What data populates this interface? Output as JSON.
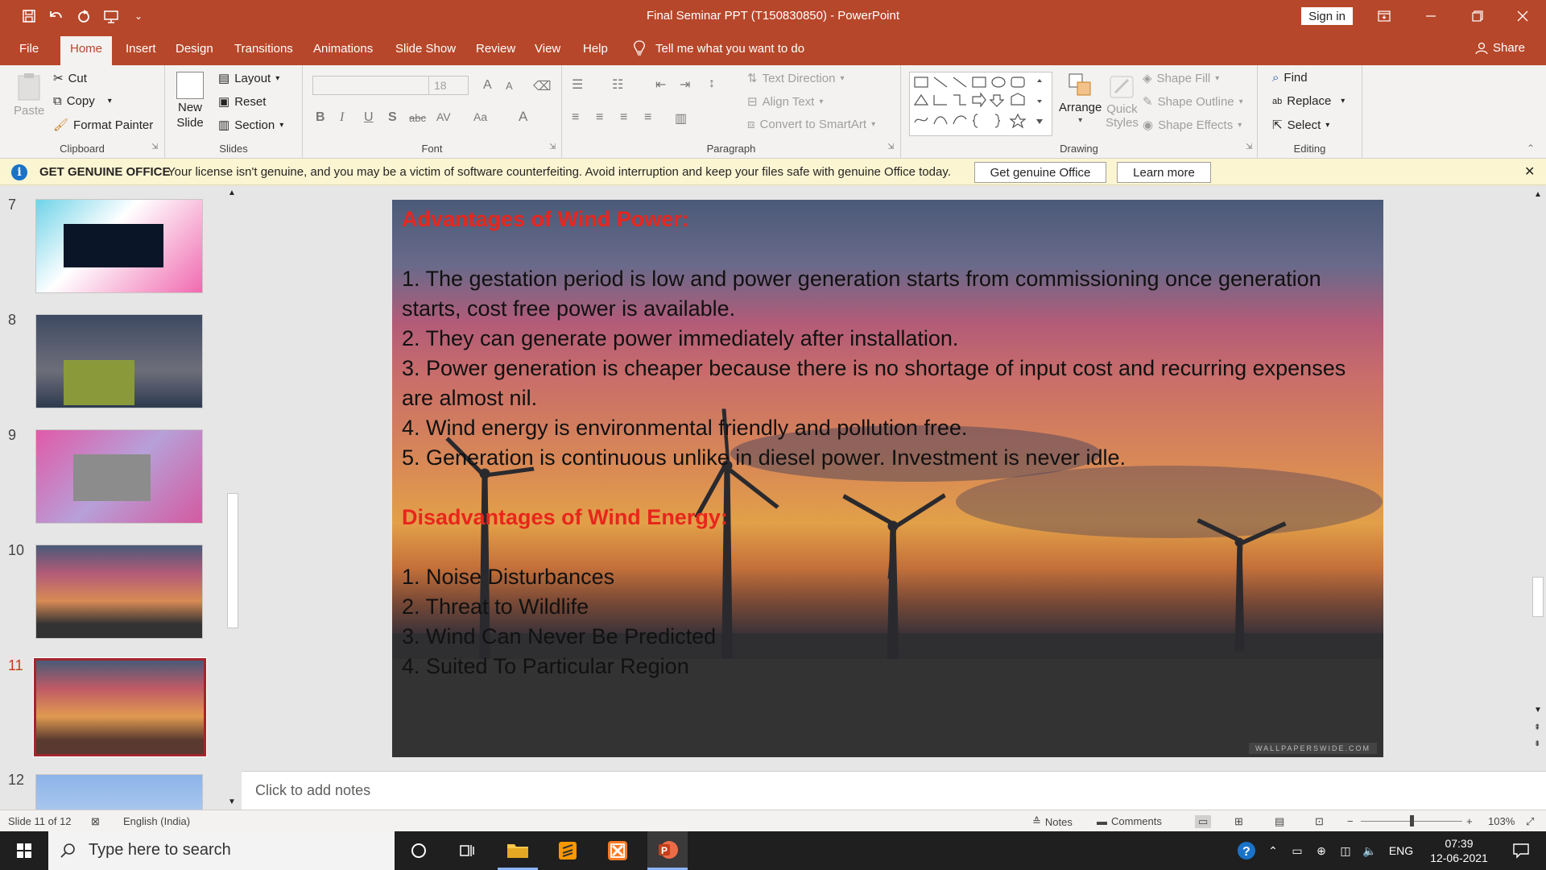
{
  "window": {
    "title": "Final Seminar PPT (T150830850)  -  PowerPoint",
    "sign_in": "Sign in",
    "qat_customize": "⌄"
  },
  "tabs": [
    "File",
    "Home",
    "Insert",
    "Design",
    "Transitions",
    "Animations",
    "Slide Show",
    "Review",
    "View",
    "Help"
  ],
  "active_tab": "Home",
  "tell_me": "Tell me what you want to do",
  "share": "Share",
  "ribbon": {
    "clipboard": {
      "label": "Clipboard",
      "paste": "Paste",
      "cut": "Cut",
      "copy": "Copy",
      "format_painter": "Format Painter"
    },
    "slides": {
      "label": "Slides",
      "new_slide_1": "New",
      "new_slide_2": "Slide",
      "layout": "Layout",
      "reset": "Reset",
      "section": "Section"
    },
    "font": {
      "label": "Font",
      "size": "18",
      "bold": "B",
      "italic": "I",
      "underline": "U",
      "shadow": "S",
      "strike": "abc",
      "spacing": "AV",
      "case": "Aa",
      "color": "A",
      "grow": "A",
      "shrink": "A"
    },
    "paragraph": {
      "label": "Paragraph",
      "text_direction": "Text Direction",
      "align_text": "Align Text",
      "convert_smartart": "Convert to SmartArt"
    },
    "drawing": {
      "label": "Drawing",
      "arrange": "Arrange",
      "quick_styles_1": "Quick",
      "quick_styles_2": "Styles",
      "shape_fill": "Shape Fill",
      "shape_outline": "Shape Outline",
      "shape_effects": "Shape Effects"
    },
    "editing": {
      "label": "Editing",
      "find": "Find",
      "replace": "Replace",
      "select": "Select"
    }
  },
  "infobar": {
    "title": "GET GENUINE OFFICE",
    "message": "Your license isn't genuine, and you may be a victim of software counterfeiting. Avoid interruption and keep your files safe with genuine Office today.",
    "btn_genuine": "Get genuine Office",
    "btn_learn": "Learn more"
  },
  "thumbnails": [
    {
      "num": "7",
      "active": false
    },
    {
      "num": "8",
      "active": false
    },
    {
      "num": "9",
      "active": false
    },
    {
      "num": "10",
      "active": false
    },
    {
      "num": "11",
      "active": true
    },
    {
      "num": "12",
      "active": false
    }
  ],
  "slide": {
    "heading_adv": "Advantages of Wind Power:",
    "adv": [
      "1. The gestation period is low and power generation starts from commissioning once generation starts, cost free power is available.",
      "2. They can generate power immediately after installation.",
      "3. Power generation is cheaper because there is no shortage of input cost and recurring expenses are almost nil.",
      "4. Wind energy is environmental friendly and pollution free.",
      "5. Generation is continuous unlike in diesel power. Investment is never idle."
    ],
    "heading_dis": "Disadvantages of Wind Energy:",
    "dis": [
      "1. Noise Disturbances",
      "2. Threat to Wildlife",
      "3. Wind Can Never Be Predicted",
      "4. Suited To Particular Region"
    ],
    "watermark": "WALLPAPERSWIDE.COM"
  },
  "notes_placeholder": "Click to add notes",
  "status": {
    "slide_of": "Slide 11 of 12",
    "language": "English (India)",
    "notes": "Notes",
    "comments": "Comments",
    "zoom": "103%"
  },
  "taskbar": {
    "search_placeholder": "Type here to search",
    "lang": "ENG",
    "time": "07:39",
    "date": "12-06-2021"
  },
  "colors": {
    "accent": "#b7472a",
    "heading_red": "#e8261c"
  }
}
